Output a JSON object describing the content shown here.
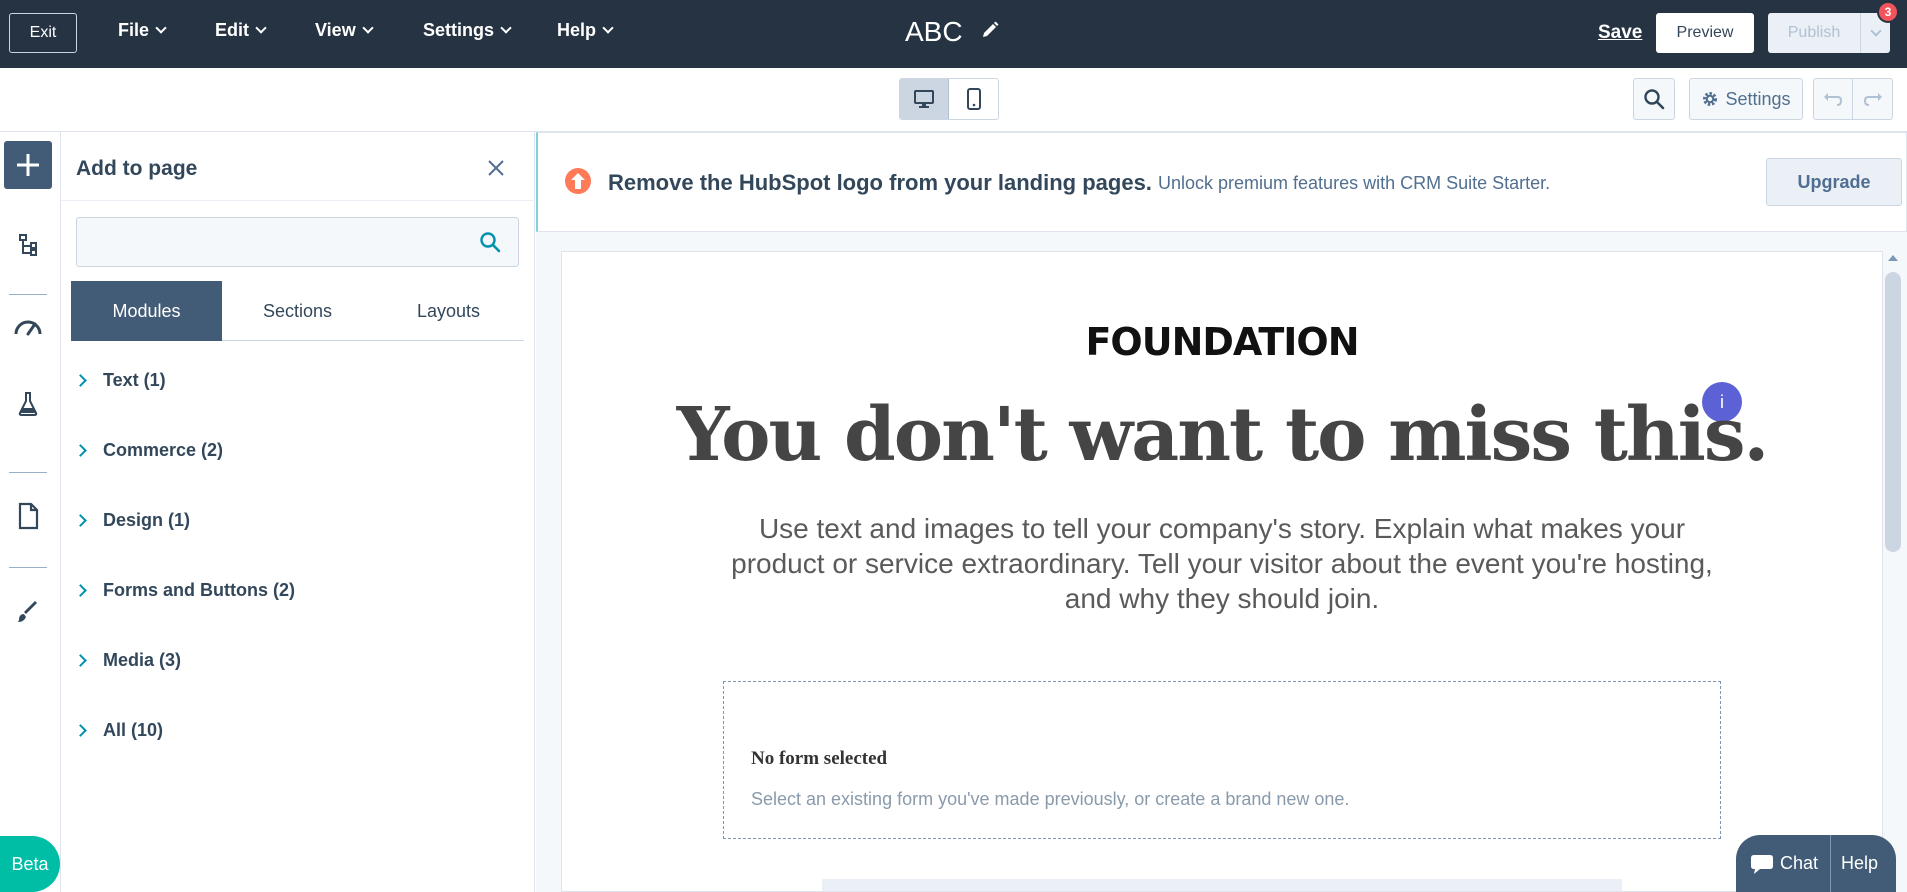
{
  "topbar": {
    "exit_label": "Exit",
    "menus": [
      "File",
      "Edit",
      "View",
      "Settings",
      "Help"
    ],
    "document_title": "ABC",
    "save_label": "Save",
    "preview_label": "Preview",
    "publish_label": "Publish",
    "notification_count": "3"
  },
  "toolbar": {
    "settings_label": "Settings"
  },
  "rail": {
    "beta_label": "Beta"
  },
  "panel": {
    "title": "Add to page",
    "search_placeholder": "",
    "tabs": [
      "Modules",
      "Sections",
      "Layouts"
    ],
    "active_tab": "Modules",
    "categories": [
      "Text (1)",
      "Commerce (2)",
      "Design (1)",
      "Forms and Buttons (2)",
      "Media (3)",
      "All (10)"
    ]
  },
  "banner": {
    "strong": "Remove the HubSpot logo from your landing pages.",
    "text": "Unlock premium features with CRM Suite Starter.",
    "upgrade_label": "Upgrade"
  },
  "page": {
    "brand": "FOUNDATION",
    "info_label": "i",
    "headline": "You don't want to miss this.",
    "subtext": "Use text and images to tell your company's story. Explain what makes your product or service extraordinary. Tell your visitor about the event you're hosting, and why they should join.",
    "form_title": "No form selected",
    "form_text": "Select an existing form you've made previously, or create a brand new one."
  },
  "chat": {
    "chat_label": "Chat",
    "help_label": "Help"
  },
  "colors": {
    "topbar": "#253342",
    "accent_teal": "#00bda5",
    "panel_active_tab": "#425b76",
    "alert_orange": "#ff7a59"
  }
}
